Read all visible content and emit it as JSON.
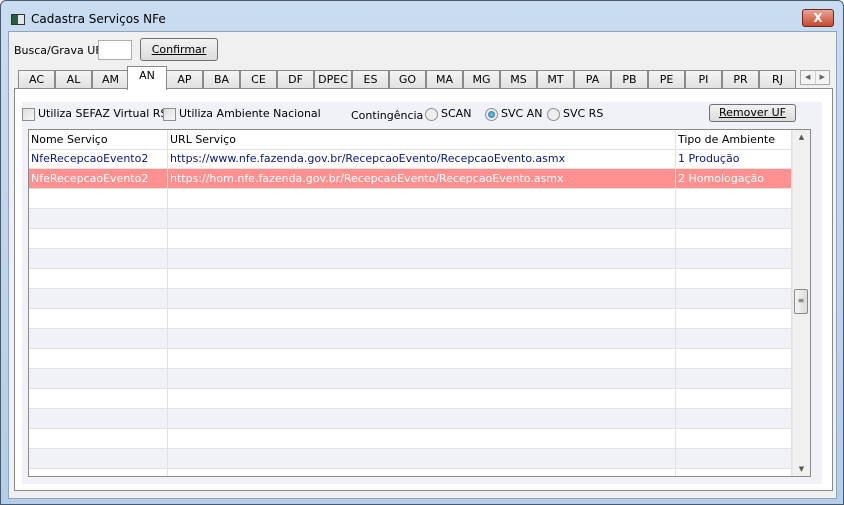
{
  "window": {
    "title": "Cadastra Serviços NFe",
    "close_label": "X"
  },
  "search": {
    "label": "Busca/Grava UF",
    "value": "",
    "confirm_label": "Confirmar"
  },
  "tabs": [
    "AC",
    "AL",
    "AM",
    "AN",
    "AP",
    "BA",
    "CE",
    "DF",
    "DPEC",
    "ES",
    "GO",
    "MA",
    "MG",
    "MS",
    "MT",
    "PA",
    "PB",
    "PE",
    "PI",
    "PR",
    "RJ"
  ],
  "active_tab": "AN",
  "options": {
    "sefaz_virtual_rs": "Utiliza SEFAZ Virtual RS",
    "ambiente_nacional": "Utiliza Ambiente Nacional",
    "contingencia_label": "Contingência",
    "radios": [
      "SCAN",
      "SVC AN",
      "SVC RS"
    ],
    "selected_radio": "SVC AN",
    "remove_label": "Remover UF"
  },
  "table": {
    "columns": [
      "Nome Serviço",
      "URL Serviço",
      "Tipo de Ambiente"
    ],
    "rows": [
      [
        "NfeRecepcaoEvento2",
        "https://www.nfe.fazenda.gov.br/RecepcaoEvento/RecepcaoEvento.asmx",
        "1 Produção"
      ],
      [
        "NfeRecepcaoEvento2",
        "https://hom.nfe.fazenda.gov.br/RecepcaoEvento/RecepcaoEvento.asmx",
        "2 Homologação"
      ]
    ],
    "selected_row": 1
  },
  "colors": {
    "selection": "#ff9191",
    "link_text": "#0b1a7a"
  }
}
